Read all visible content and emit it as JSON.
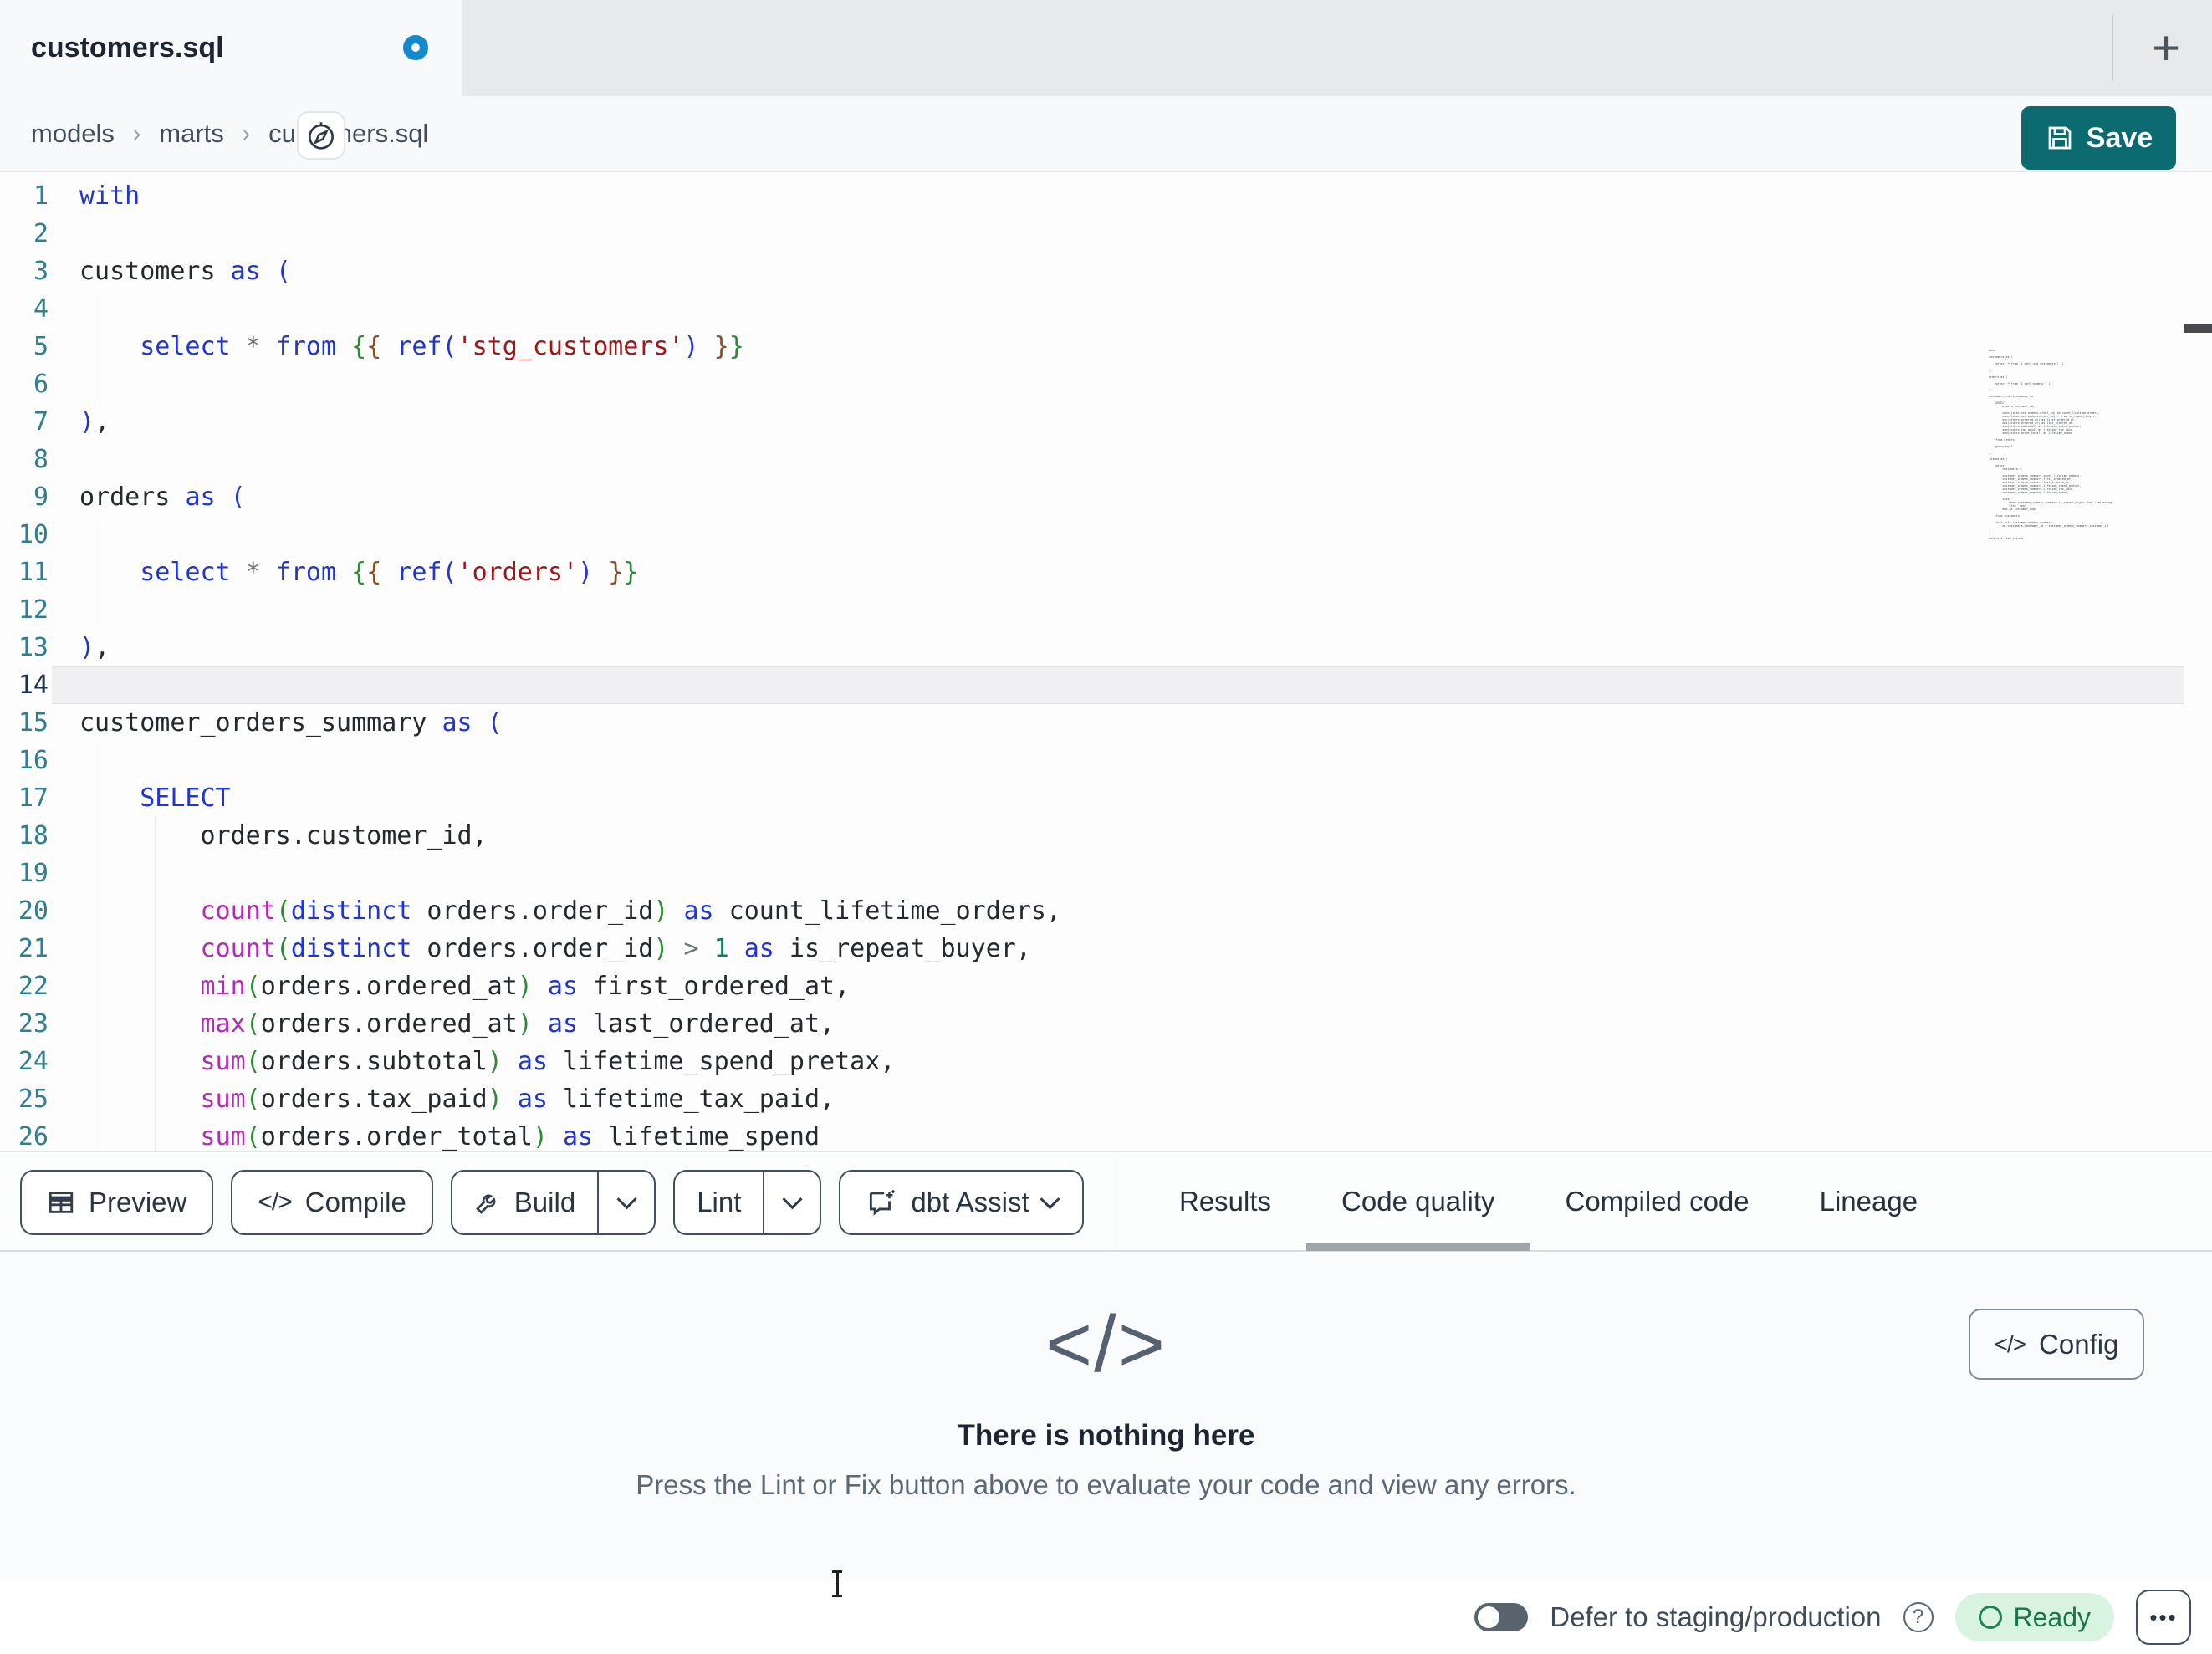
{
  "icons": {
    "plus": "+",
    "compile_glyph": "</>",
    "empty_glyph": "</>",
    "config_glyph": "</>",
    "help": "?",
    "more": "•••"
  },
  "tabbar": {
    "title": "customers.sql"
  },
  "breadcrumb": {
    "sep": "›",
    "items": [
      "models",
      "marts",
      "customers.sql"
    ]
  },
  "save": {
    "label": "Save"
  },
  "toolbar": {
    "preview": "Preview",
    "compile": "Compile",
    "build": "Build",
    "lint": "Lint",
    "assist": "dbt Assist"
  },
  "panel_tabs": [
    {
      "label": "Results",
      "active": false
    },
    {
      "label": "Code quality",
      "active": true
    },
    {
      "label": "Compiled code",
      "active": false
    },
    {
      "label": "Lineage",
      "active": false
    }
  ],
  "panel": {
    "empty_title": "There is nothing here",
    "empty_subtitle": "Press the Lint or Fix button above to evaluate your code and view any errors.",
    "config": "Config"
  },
  "statusbar": {
    "defer_label": "Defer to staging/production",
    "ready": "Ready"
  },
  "colors": {
    "accent_teal": "#0c6b71",
    "unsaved_blue": "#1488cc",
    "ready_bg": "#d8f3e0",
    "ready_text": "#17754b",
    "keyword_blue": "#2036cf",
    "function_magenta": "#b52bb5",
    "string_red": "#a31515"
  },
  "editor": {
    "lines": [
      {
        "n": 1,
        "tokens": [
          [
            "kw",
            "with"
          ]
        ]
      },
      {
        "n": 2,
        "tokens": []
      },
      {
        "n": 3,
        "tokens": [
          [
            "pl",
            "customers "
          ],
          [
            "kw",
            "as"
          ],
          [
            "pl",
            " "
          ],
          [
            "b1",
            "("
          ]
        ]
      },
      {
        "n": 4,
        "tokens": [],
        "guides": [
          0
        ]
      },
      {
        "n": 5,
        "tokens": [
          [
            "pl",
            "    "
          ],
          [
            "kw",
            "select"
          ],
          [
            "pl",
            " "
          ],
          [
            "op",
            "*"
          ],
          [
            "pl",
            " "
          ],
          [
            "kw",
            "from"
          ],
          [
            "pl",
            " "
          ],
          [
            "b2",
            "{"
          ],
          [
            "b3",
            "{"
          ],
          [
            "pl",
            " "
          ],
          [
            "kw",
            "ref"
          ],
          [
            "b1",
            "("
          ],
          [
            "str",
            "'stg_customers'"
          ],
          [
            "b1",
            ")"
          ],
          [
            "pl",
            " "
          ],
          [
            "b3",
            "}"
          ],
          [
            "b2",
            "}"
          ]
        ],
        "guides": [
          0
        ]
      },
      {
        "n": 6,
        "tokens": [],
        "guides": [
          0
        ]
      },
      {
        "n": 7,
        "tokens": [
          [
            "b1",
            ")"
          ],
          [
            "pl",
            ","
          ]
        ]
      },
      {
        "n": 8,
        "tokens": []
      },
      {
        "n": 9,
        "tokens": [
          [
            "pl",
            "orders "
          ],
          [
            "kw",
            "as"
          ],
          [
            "pl",
            " "
          ],
          [
            "b1",
            "("
          ]
        ]
      },
      {
        "n": 10,
        "tokens": [],
        "guides": [
          0
        ]
      },
      {
        "n": 11,
        "tokens": [
          [
            "pl",
            "    "
          ],
          [
            "kw",
            "select"
          ],
          [
            "pl",
            " "
          ],
          [
            "op",
            "*"
          ],
          [
            "pl",
            " "
          ],
          [
            "kw",
            "from"
          ],
          [
            "pl",
            " "
          ],
          [
            "b2",
            "{"
          ],
          [
            "b3",
            "{"
          ],
          [
            "pl",
            " "
          ],
          [
            "kw",
            "ref"
          ],
          [
            "b1",
            "("
          ],
          [
            "str",
            "'orders'"
          ],
          [
            "b1",
            ")"
          ],
          [
            "pl",
            " "
          ],
          [
            "b3",
            "}"
          ],
          [
            "b2",
            "}"
          ]
        ],
        "guides": [
          0
        ]
      },
      {
        "n": 12,
        "tokens": [],
        "guides": [
          0
        ]
      },
      {
        "n": 13,
        "tokens": [
          [
            "b1",
            ")"
          ],
          [
            "pl",
            ","
          ]
        ]
      },
      {
        "n": 14,
        "tokens": [],
        "active": true
      },
      {
        "n": 15,
        "tokens": [
          [
            "pl",
            "customer_orders_summary "
          ],
          [
            "kw",
            "as"
          ],
          [
            "pl",
            " "
          ],
          [
            "b1",
            "("
          ]
        ]
      },
      {
        "n": 16,
        "tokens": [],
        "guides": [
          0
        ]
      },
      {
        "n": 17,
        "tokens": [
          [
            "pl",
            "    "
          ],
          [
            "kw",
            "SELECT"
          ]
        ],
        "guides": [
          0
        ]
      },
      {
        "n": 18,
        "tokens": [
          [
            "pl",
            "        orders.customer_id,"
          ]
        ],
        "guides": [
          0,
          4
        ]
      },
      {
        "n": 19,
        "tokens": [],
        "guides": [
          0,
          4
        ]
      },
      {
        "n": 20,
        "tokens": [
          [
            "pl",
            "        "
          ],
          [
            "fn",
            "count"
          ],
          [
            "b2",
            "("
          ],
          [
            "kw",
            "distinct"
          ],
          [
            "pl",
            " orders.order_id"
          ],
          [
            "b2",
            ")"
          ],
          [
            "pl",
            " "
          ],
          [
            "kw",
            "as"
          ],
          [
            "pl",
            " count_lifetime_orders,"
          ]
        ],
        "guides": [
          0,
          4
        ]
      },
      {
        "n": 21,
        "tokens": [
          [
            "pl",
            "        "
          ],
          [
            "fn",
            "count"
          ],
          [
            "b2",
            "("
          ],
          [
            "kw",
            "distinct"
          ],
          [
            "pl",
            " orders.order_id"
          ],
          [
            "b2",
            ")"
          ],
          [
            "pl",
            " "
          ],
          [
            "op",
            ">"
          ],
          [
            "pl",
            " "
          ],
          [
            "num",
            "1"
          ],
          [
            "pl",
            " "
          ],
          [
            "kw",
            "as"
          ],
          [
            "pl",
            " is_repeat_buyer,"
          ]
        ],
        "guides": [
          0,
          4
        ]
      },
      {
        "n": 22,
        "tokens": [
          [
            "pl",
            "        "
          ],
          [
            "fn",
            "min"
          ],
          [
            "b2",
            "("
          ],
          [
            "pl",
            "orders.ordered_at"
          ],
          [
            "b2",
            ")"
          ],
          [
            "pl",
            " "
          ],
          [
            "kw",
            "as"
          ],
          [
            "pl",
            " first_ordered_at,"
          ]
        ],
        "guides": [
          0,
          4
        ]
      },
      {
        "n": 23,
        "tokens": [
          [
            "pl",
            "        "
          ],
          [
            "fn",
            "max"
          ],
          [
            "b2",
            "("
          ],
          [
            "pl",
            "orders.ordered_at"
          ],
          [
            "b2",
            ")"
          ],
          [
            "pl",
            " "
          ],
          [
            "kw",
            "as"
          ],
          [
            "pl",
            " last_ordered_at,"
          ]
        ],
        "guides": [
          0,
          4
        ]
      },
      {
        "n": 24,
        "tokens": [
          [
            "pl",
            "        "
          ],
          [
            "fn",
            "sum"
          ],
          [
            "b2",
            "("
          ],
          [
            "pl",
            "orders.subtotal"
          ],
          [
            "b2",
            ")"
          ],
          [
            "pl",
            " "
          ],
          [
            "kw",
            "as"
          ],
          [
            "pl",
            " lifetime_spend_pretax,"
          ]
        ],
        "guides": [
          0,
          4
        ]
      },
      {
        "n": 25,
        "tokens": [
          [
            "pl",
            "        "
          ],
          [
            "fn",
            "sum"
          ],
          [
            "b2",
            "("
          ],
          [
            "pl",
            "orders.tax_paid"
          ],
          [
            "b2",
            ")"
          ],
          [
            "pl",
            " "
          ],
          [
            "kw",
            "as"
          ],
          [
            "pl",
            " lifetime_tax_paid,"
          ]
        ],
        "guides": [
          0,
          4
        ]
      },
      {
        "n": 26,
        "tokens": [
          [
            "pl",
            "        "
          ],
          [
            "fn",
            "sum"
          ],
          [
            "b2",
            "("
          ],
          [
            "pl",
            "orders.order_total"
          ],
          [
            "b2",
            ")"
          ],
          [
            "pl",
            " "
          ],
          [
            "kw",
            "as"
          ],
          [
            "pl",
            " lifetime_spend"
          ]
        ],
        "guides": [
          0,
          4
        ]
      }
    ],
    "minimap_lines": [
      "with",
      "",
      "customers as (",
      "",
      "    select * from {{ ref('stg_customers') }}",
      "",
      "),",
      "",
      "orders as (",
      "",
      "    select * from {{ ref('orders') }}",
      "",
      "),",
      "",
      "customer_orders_summary as (",
      "",
      "    SELECT",
      "        orders.customer_id,",
      "",
      "        count(distinct orders.order_id) as count_lifetime_orders,",
      "        count(distinct orders.order_id) > 1 as is_repeat_buyer,",
      "        min(orders.ordered_at) as first_ordered_at,",
      "        max(orders.ordered_at) as last_ordered_at,",
      "        sum(orders.subtotal) as lifetime_spend_pretax,",
      "        sum(orders.tax_paid) as lifetime_tax_paid,",
      "        sum(orders.order_total) as lifetime_spend",
      "",
      "    from orders",
      "",
      "    group by 1",
      "",
      "),",
      "",
      "joined as (",
      "",
      "    select",
      "        customers.*,",
      "",
      "        customer_orders_summary.count_lifetime_orders,",
      "        customer_orders_summary.first_ordered_at,",
      "        customer_orders_summary.last_ordered_at,",
      "        customer_orders_summary.lifetime_spend_pretax,",
      "        customer_orders_summary.lifetime_tax_paid,",
      "        customer_orders_summary.lifetime_spend,",
      "",
      "        case",
      "            when customer_orders_summary.is_repeat_buyer then 'returning'",
      "            else 'new'",
      "        end as customer_type",
      "",
      "    from customers",
      "",
      "    left join customer_orders_summary",
      "        on customers.customer_id = customer_orders_summary.customer_id",
      "",
      ")",
      "",
      "select * from joined"
    ]
  }
}
